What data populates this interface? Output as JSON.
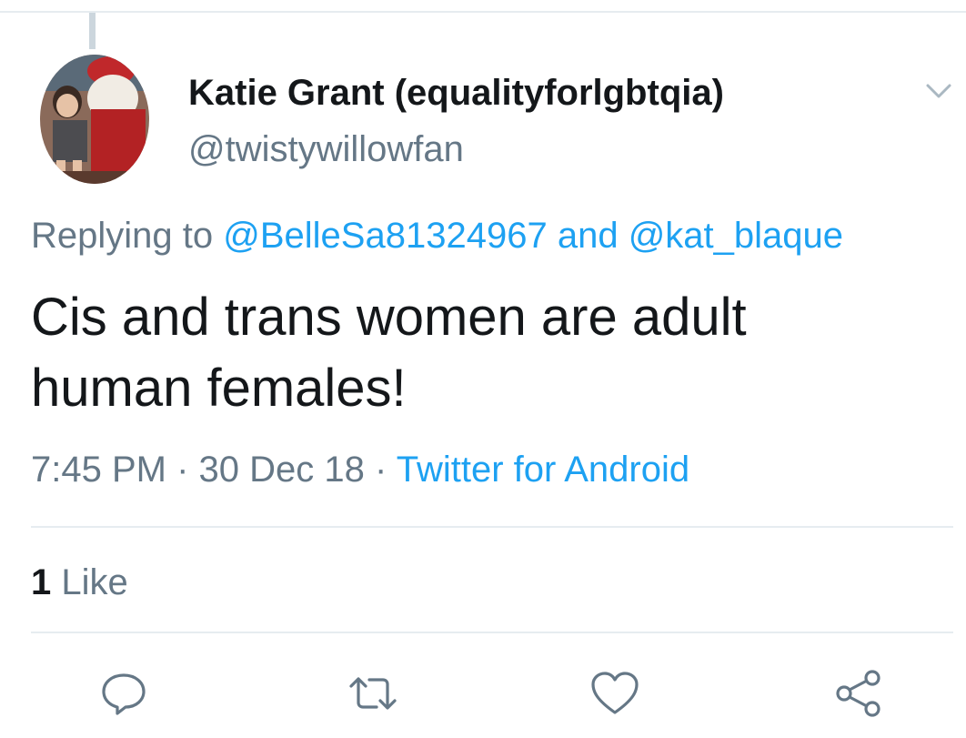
{
  "tweet": {
    "display_name": "Katie Grant (equalityforlgbtqia)",
    "handle": "@twistywillowfan",
    "replying_prefix": "Replying to",
    "reply_to_1": "@BelleSa81324967",
    "reply_joiner": "and",
    "reply_to_2": "@kat_blaque",
    "text_line_1": "Cis and trans women are adult",
    "text_line_2": "human females!",
    "time": "7:45 PM",
    "sep": "·",
    "date": "30 Dec 18",
    "source": "Twitter for Android",
    "likes_count": "1",
    "likes_label": "Like"
  },
  "icons": {
    "caret": "chevron-down-icon",
    "reply": "reply-icon",
    "retweet": "retweet-icon",
    "like": "heart-icon",
    "share": "share-icon"
  },
  "colors": {
    "link": "#1da1f2",
    "text": "#14171a",
    "secondary": "#657786",
    "border": "#e6ecf0"
  }
}
